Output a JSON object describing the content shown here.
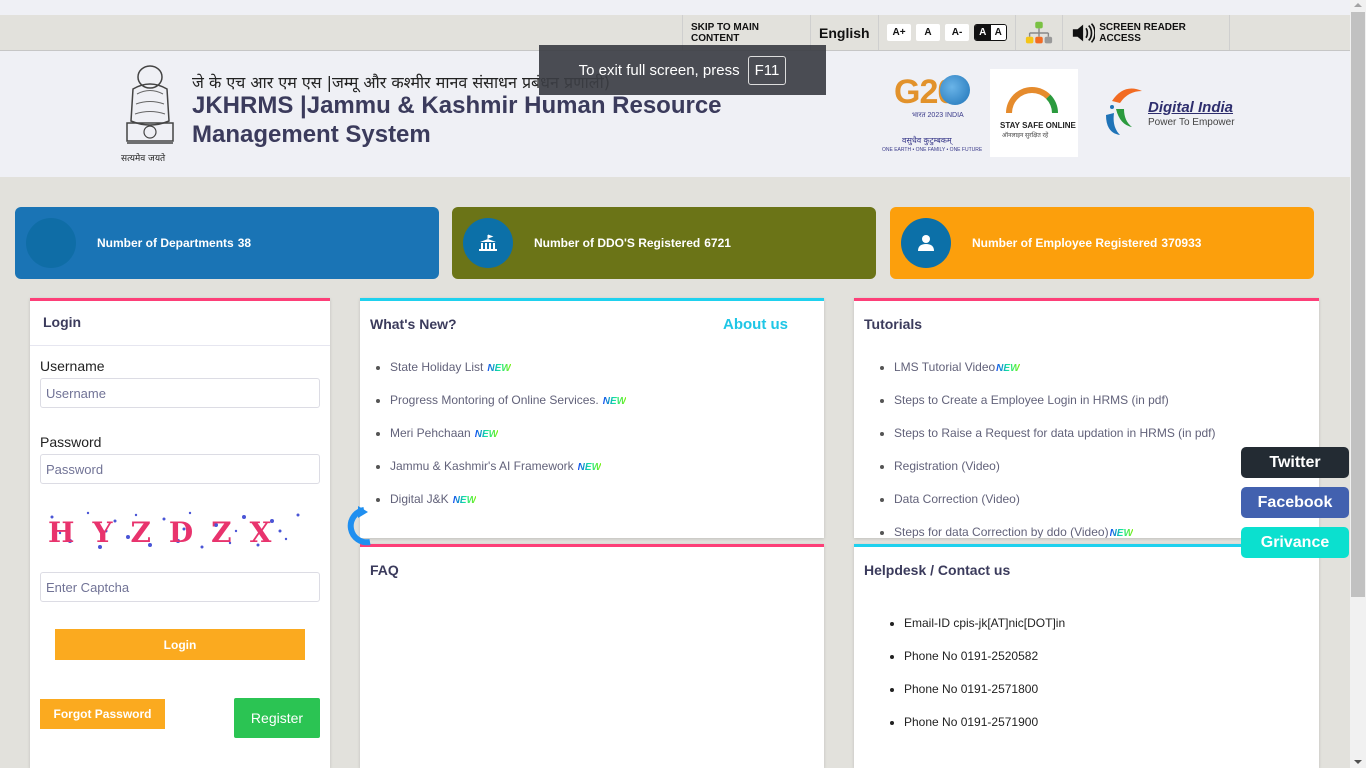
{
  "accessibility_bar": {
    "skip_label": "SKIP TO MAIN CONTENT",
    "language": "English",
    "font_sizes": [
      "A+",
      "A",
      "A-"
    ],
    "contrast": [
      "A",
      "A"
    ],
    "screen_reader_label": "SCREEN READER ACCESS"
  },
  "header": {
    "hindi_title": "जे के एच आर एम एस |जम्मू और कश्मीर मानव संसाधन प्रबंधन प्रणाली)",
    "english_title": "JKHRMS |Jammu & Kashmir Human Resource Management System",
    "emblem_caption": "सत्यमेव जयते",
    "logos": {
      "g20": {
        "text": "G20",
        "sub1": "भारत 2023 INDIA",
        "sub2": "वसुधैव कुटुम्बकम्",
        "sub3": "ONE EARTH • ONE FAMILY • ONE FUTURE"
      },
      "stay_safe": {
        "title": "STAY SAFE ONLINE",
        "sub": "ऑनलाइन सुरक्षित रहें"
      },
      "digital_india": {
        "title": "Digital India",
        "tagline": "Power To Empower"
      }
    }
  },
  "fullscreen_notice": {
    "text": "To exit full screen, press",
    "key": "F11"
  },
  "stats": [
    {
      "label": "Number of Departments",
      "value": "38",
      "color": "#1a74b5"
    },
    {
      "label": "Number of DDO'S Registered",
      "value": "6721",
      "color": "#6b7417"
    },
    {
      "label": "Number of Employee Registered",
      "value": "370933",
      "color": "#fc9f0c"
    }
  ],
  "login": {
    "title": "Login",
    "username_label": "Username",
    "username_placeholder": "Username",
    "password_label": "Password",
    "password_placeholder": "Password",
    "captcha_text": "HYZDZX",
    "captcha_placeholder": "Enter Captcha",
    "login_button": "Login",
    "forgot_button": "Forgot Password",
    "register_button": "Register"
  },
  "whats_new": {
    "title": "What's New?",
    "about_link": "About us",
    "badge": "NEW",
    "items": [
      "State Holiday List",
      "Progress Montoring of Online Services.",
      "Meri Pehchaan",
      "Jammu & Kashmir's AI Framework",
      "Digital J&K"
    ]
  },
  "tutorials": {
    "title": "Tutorials",
    "items": [
      {
        "text": "LMS Tutorial Video",
        "new": true
      },
      {
        "text": "Steps to Create a Employee Login in HRMS (in pdf)",
        "new": false
      },
      {
        "text": "Steps to Raise a Request for data updation in HRMS (in pdf)",
        "new": false
      },
      {
        "text": "Registration (Video)",
        "new": false
      },
      {
        "text": "Data Correction (Video)",
        "new": false
      },
      {
        "text": "Steps for data Correction by ddo (Video)",
        "new": true
      }
    ]
  },
  "faq": {
    "title": "FAQ"
  },
  "helpdesk": {
    "title": "Helpdesk / Contact us",
    "items": [
      "Email-ID cpis-jk[AT]nic[DOT]in",
      "Phone No 0191-2520582",
      "Phone No 0191-2571800",
      "Phone No 0191-2571900"
    ]
  },
  "social": {
    "twitter": "Twitter",
    "facebook": "Facebook",
    "grievance": "Grivance"
  }
}
